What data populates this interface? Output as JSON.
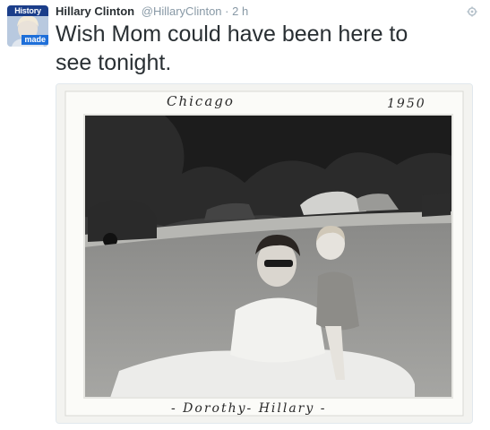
{
  "tweet": {
    "avatar": {
      "badge_top": "History",
      "badge_bottom": "made"
    },
    "author": {
      "name": "Hillary Clinton",
      "handle": "@HillaryClinton"
    },
    "separator": "·",
    "timestamp": "2 h",
    "text": "Wish Mom could have been here to see tonight.",
    "photo": {
      "caption_place": "Chicago",
      "caption_year": "1950",
      "caption_names": "- Dorothy- Hillary -"
    }
  },
  "icons": {
    "more": "gear-icon",
    "avatar": "portrait"
  },
  "colors": {
    "name": "#292f33",
    "meta": "#8899a6",
    "avatar_top": "#1b3e8a",
    "avatar_bottom": "#1e6fd9"
  }
}
